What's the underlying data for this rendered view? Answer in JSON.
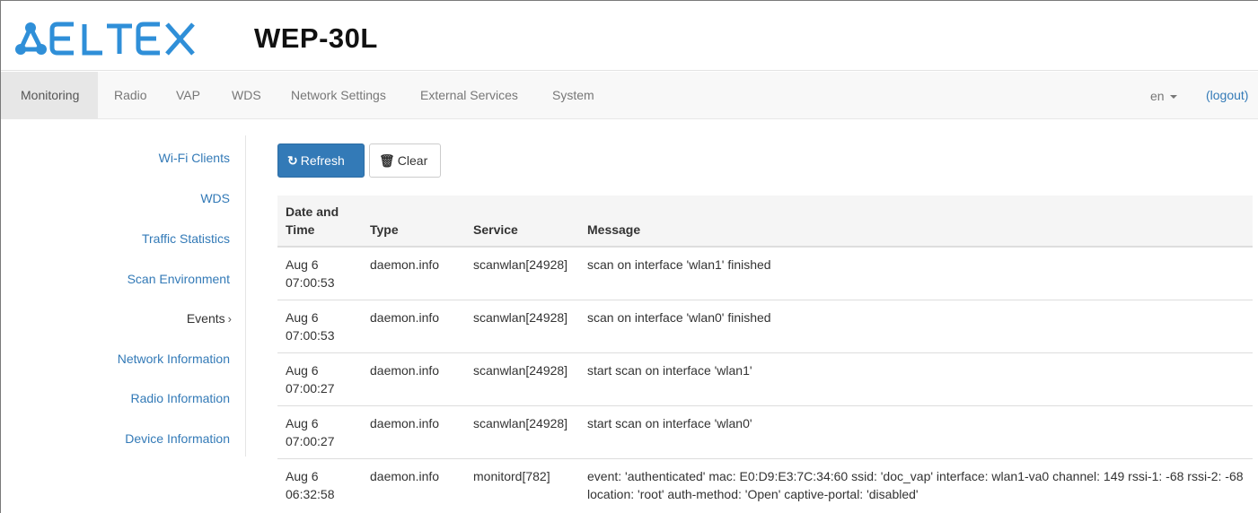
{
  "header": {
    "brand": "ELTEX",
    "device_title": "WEP-30L"
  },
  "navbar": {
    "items": [
      {
        "label": "Monitoring",
        "active": true
      },
      {
        "label": "Radio"
      },
      {
        "label": "VAP"
      },
      {
        "label": "WDS"
      },
      {
        "label": "Network Settings"
      },
      {
        "label": "External Services"
      },
      {
        "label": "System"
      }
    ],
    "language": "en",
    "logout": "(logout)"
  },
  "sidebar": {
    "items": [
      {
        "label": "Wi-Fi Clients"
      },
      {
        "label": "WDS"
      },
      {
        "label": "Traffic Statistics"
      },
      {
        "label": "Scan Environment"
      },
      {
        "label": "Events",
        "active": true,
        "suffix": "›"
      },
      {
        "label": "Network Information"
      },
      {
        "label": "Radio Information"
      },
      {
        "label": "Device Information"
      }
    ]
  },
  "toolbar": {
    "refresh_label": "Refresh",
    "clear_label": "Clear",
    "refresh_icon": "refresh-icon",
    "clear_icon": "trash-icon"
  },
  "events_table": {
    "headers": {
      "date_time_line1": "Date and",
      "date_time_line2": "Time",
      "type": "Type",
      "service": "Service",
      "message": "Message"
    },
    "rows": [
      {
        "date": "Aug 6",
        "time": "07:00:53",
        "type": "daemon.info",
        "service": "scanwlan[24928]",
        "message": "scan on interface 'wlan1' finished"
      },
      {
        "date": "Aug 6",
        "time": "07:00:53",
        "type": "daemon.info",
        "service": "scanwlan[24928]",
        "message": "scan on interface 'wlan0' finished"
      },
      {
        "date": "Aug 6",
        "time": "07:00:27",
        "type": "daemon.info",
        "service": "scanwlan[24928]",
        "message": "start scan on interface 'wlan1'"
      },
      {
        "date": "Aug 6",
        "time": "07:00:27",
        "type": "daemon.info",
        "service": "scanwlan[24928]",
        "message": "start scan on interface 'wlan0'"
      },
      {
        "date": "Aug 6",
        "time": "06:32:58",
        "type": "daemon.info",
        "service": "monitord[782]",
        "message": "event: 'authenticated' mac: E0:D9:E3:7C:34:60 ssid: 'doc_vap' interface: wlan1-va0 channel: 149 rssi-1: -68 rssi-2: -68 location: 'root' auth-method: 'Open' captive-portal: 'disabled'"
      }
    ]
  },
  "colors": {
    "brand_blue": "#2f8fd8",
    "link": "#337ab7",
    "primary_button": "#337ab7"
  }
}
